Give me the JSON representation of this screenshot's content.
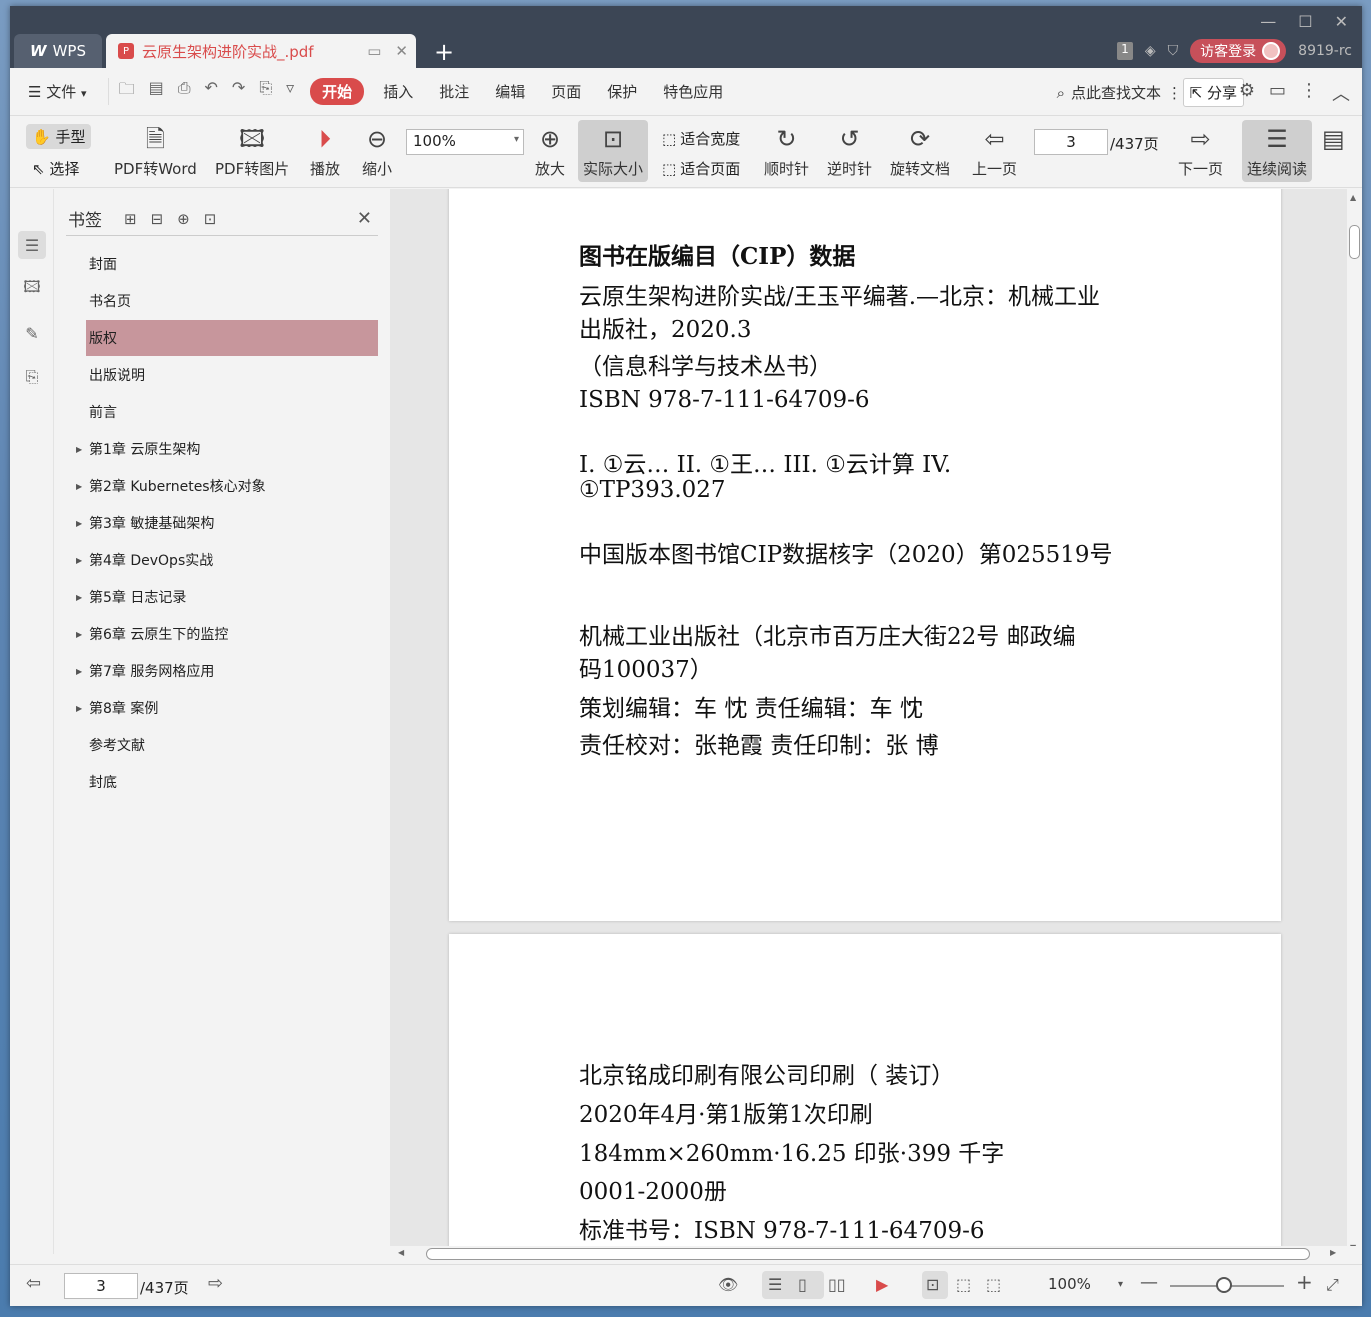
{
  "titlebar": {
    "app_name": "WPS",
    "doc_tab_title": "云原生架构进阶实战_.pdf",
    "badge_count": "1",
    "login_label": "访客登录",
    "version": "8919-rc"
  },
  "menubar": {
    "file_label": "文件",
    "tabs": [
      "开始",
      "插入",
      "批注",
      "编辑",
      "页面",
      "保护",
      "特色应用"
    ],
    "search_label": "点此查找文本",
    "share_label": "分享"
  },
  "toolbar": {
    "hand": "手型",
    "select": "选择",
    "pdf_to_word": "PDF转Word",
    "pdf_to_image": "PDF转图片",
    "play": "播放",
    "zoom_out": "缩小",
    "zoom_value": "100%",
    "zoom_in": "放大",
    "actual_size": "实际大小",
    "fit_width": "适合宽度",
    "fit_page": "适合页面",
    "clockwise": "顺时针",
    "counterclockwise": "逆时针",
    "rotate_doc": "旋转文档",
    "prev_page": "上一页",
    "page_number": "3",
    "page_total": "/437页",
    "next_page": "下一页",
    "continuous": "连续阅读"
  },
  "bookmarks": {
    "title": "书签",
    "items": [
      {
        "label": "封面",
        "expandable": false,
        "selected": false
      },
      {
        "label": "书名页",
        "expandable": false,
        "selected": false
      },
      {
        "label": "版权",
        "expandable": false,
        "selected": true
      },
      {
        "label": "出版说明",
        "expandable": false,
        "selected": false
      },
      {
        "label": "前言",
        "expandable": false,
        "selected": false
      },
      {
        "label": "第1章 云原生架构",
        "expandable": true,
        "selected": false
      },
      {
        "label": "第2章 Kubernetes核心对象",
        "expandable": true,
        "selected": false
      },
      {
        "label": "第3章 敏捷基础架构",
        "expandable": true,
        "selected": false
      },
      {
        "label": "第4章 DevOps实战",
        "expandable": true,
        "selected": false
      },
      {
        "label": "第5章 日志记录",
        "expandable": true,
        "selected": false
      },
      {
        "label": "第6章 云原生下的监控",
        "expandable": true,
        "selected": false
      },
      {
        "label": "第7章 服务网格应用",
        "expandable": true,
        "selected": false
      },
      {
        "label": "第8章 案例",
        "expandable": true,
        "selected": false
      },
      {
        "label": "参考文献",
        "expandable": false,
        "selected": false
      },
      {
        "label": "封底",
        "expandable": false,
        "selected": false
      }
    ]
  },
  "page1": {
    "heading": "图书在版编目（CIP）数据",
    "lines": [
      "云原生架构进阶实战/王玉平编著.—北京：机械工业",
      "出版社，2020.3",
      "（信息科学与技术丛书）",
      "ISBN 978-7-111-64709-6",
      "I. ①云…   II. ①王…   III. ①云计算   IV.",
      "①TP393.027",
      "中国版本图书馆CIP数据核字（2020）第025519号",
      "机械工业出版社（北京市百万庄大街22号   邮政编",
      "码100037）",
      "策划编辑：车   忱        责任编辑：车   忱",
      "责任校对：张艳霞        责任印制：张   博"
    ]
  },
  "page2": {
    "lines": [
      "北京铭成印刷有限公司印刷（ 装订）",
      "2020年4月·第1版第1次印刷",
      "184mm×260mm·16.25 印张·399 千字",
      "0001-2000册",
      "标准书号：ISBN 978-7-111-64709-6"
    ]
  },
  "statusbar": {
    "page_number": "3",
    "page_total": "/437页",
    "zoom": "100%"
  },
  "colors": {
    "accent": "#d94b4b",
    "titlebar_bg": "#3c4655",
    "selected_bookmark": "#c7969c"
  }
}
